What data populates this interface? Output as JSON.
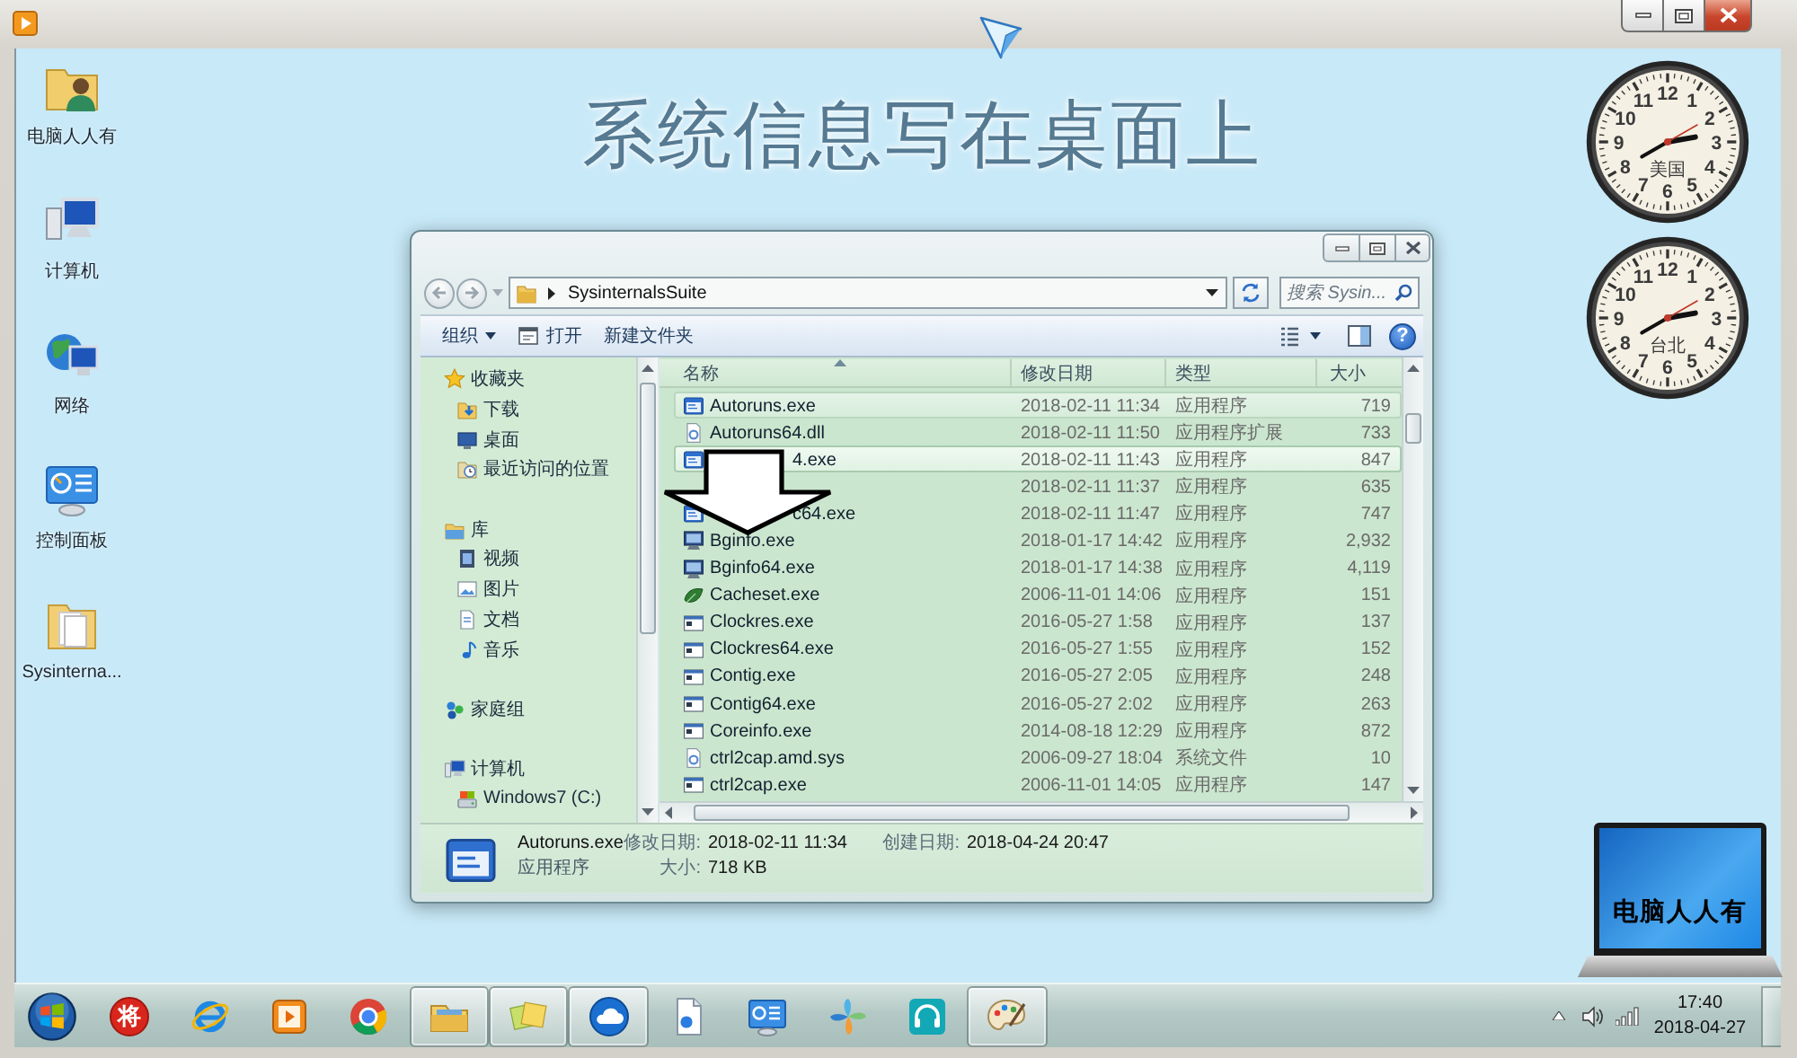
{
  "desktop": {
    "title": "系统信息写在桌面上",
    "icons": [
      {
        "label": "电脑人人有",
        "kind": "user-folder"
      },
      {
        "label": "计算机",
        "kind": "computer"
      },
      {
        "label": "网络",
        "kind": "network"
      },
      {
        "label": "控制面板",
        "kind": "control-panel"
      },
      {
        "label": "Sysinterna...",
        "kind": "folder"
      }
    ]
  },
  "gadgets": {
    "clocks": [
      {
        "city": "美国",
        "numerals": [
          "12",
          "11",
          "1",
          "10",
          "2",
          "9",
          "3",
          "8",
          "4",
          "7",
          "5",
          "6"
        ]
      },
      {
        "city": "台北",
        "numerals": [
          "12",
          "11",
          "1",
          "10",
          "2",
          "9",
          "3",
          "8",
          "4",
          "7",
          "5",
          "6"
        ]
      }
    ],
    "laptop": {
      "screen_text": "电脑人人有"
    }
  },
  "explorer": {
    "address": {
      "path": "SysinternalsSuite"
    },
    "search": {
      "placeholder": "搜索 Sysin..."
    },
    "commands": [
      {
        "label": "组织",
        "kind": "menu"
      },
      {
        "label": "打开",
        "kind": "open"
      },
      {
        "label": "新建文件夹",
        "kind": "plain"
      }
    ],
    "help": "?",
    "nav_pane": [
      {
        "label": "收藏夹",
        "kind": "favorites",
        "children": [
          {
            "label": "下载",
            "kind": "downloads"
          },
          {
            "label": "桌面",
            "kind": "desktop"
          },
          {
            "label": "最近访问的位置",
            "kind": "recent"
          }
        ]
      },
      {
        "label": "库",
        "kind": "libraries",
        "children": [
          {
            "label": "视频",
            "kind": "videos"
          },
          {
            "label": "图片",
            "kind": "pictures"
          },
          {
            "label": "文档",
            "kind": "documents"
          },
          {
            "label": "音乐",
            "kind": "music"
          }
        ]
      },
      {
        "label": "家庭组",
        "kind": "homegroup"
      },
      {
        "label": "计算机",
        "kind": "computer",
        "children": [
          {
            "label": "Windows7 (C:)",
            "kind": "drive"
          }
        ]
      }
    ],
    "files": {
      "columns": [
        "名称",
        "修改日期",
        "类型",
        "大小"
      ],
      "rows": [
        {
          "name": "Autoruns.exe",
          "modified": "2018-02-11 11:34",
          "type": "应用程序",
          "size": "719",
          "kind": "app",
          "selected": true,
          "hovered": false,
          "covered": false
        },
        {
          "name": "Autoruns64.dll",
          "modified": "2018-02-11 11:50",
          "type": "应用程序扩展",
          "size": "733",
          "kind": "library",
          "selected": false,
          "hovered": false,
          "covered": false
        },
        {
          "name": "4.exe",
          "modified": "2018-02-11 11:43",
          "type": "应用程序",
          "size": "847",
          "kind": "app",
          "selected": false,
          "hovered": true,
          "covered": true
        },
        {
          "modified": "2018-02-11 11:37",
          "type": "应用程序",
          "size": "635",
          "selected": false,
          "hovered": false
        },
        {
          "name": "c64.exe",
          "modified": "2018-02-11 11:47",
          "type": "应用程序",
          "size": "747",
          "kind": "app",
          "selected": false,
          "hovered": false,
          "covered": true
        },
        {
          "name": "Bginfo.exe",
          "modified": "2018-01-17 14:42",
          "type": "应用程序",
          "size": "2,932",
          "kind": "monitor",
          "selected": false,
          "hovered": false,
          "covered": false
        },
        {
          "name": "Bginfo64.exe",
          "modified": "2018-01-17 14:38",
          "type": "应用程序",
          "size": "4,119",
          "kind": "monitor",
          "selected": false,
          "hovered": false,
          "covered": false
        },
        {
          "name": "Cacheset.exe",
          "modified": "2006-11-01 14:06",
          "type": "应用程序",
          "size": "151",
          "kind": "leaf",
          "selected": false,
          "hovered": false,
          "covered": false
        },
        {
          "name": "Clockres.exe",
          "modified": "2016-05-27 1:58",
          "type": "应用程序",
          "size": "137",
          "kind": "console",
          "selected": false,
          "hovered": false,
          "covered": false
        },
        {
          "name": "Clockres64.exe",
          "modified": "2016-05-27 1:55",
          "type": "应用程序",
          "size": "152",
          "kind": "console",
          "selected": false,
          "hovered": false,
          "covered": false
        },
        {
          "name": "Contig.exe",
          "modified": "2016-05-27 2:05",
          "type": "应用程序",
          "size": "248",
          "kind": "console",
          "selected": false,
          "hovered": false,
          "covered": false
        },
        {
          "name": "Contig64.exe",
          "modified": "2016-05-27 2:02",
          "type": "应用程序",
          "size": "263",
          "kind": "console",
          "selected": false,
          "hovered": false,
          "covered": false
        },
        {
          "name": "Coreinfo.exe",
          "modified": "2014-08-18 12:29",
          "type": "应用程序",
          "size": "872",
          "kind": "console",
          "selected": false,
          "hovered": false,
          "covered": false
        },
        {
          "name": "ctrl2cap.amd.sys",
          "modified": "2006-09-27 18:04",
          "type": "系统文件",
          "size": "10",
          "kind": "system",
          "selected": false,
          "hovered": false,
          "covered": false
        },
        {
          "name": "ctrl2cap.exe",
          "modified": "2006-11-01 14:05",
          "type": "应用程序",
          "size": "147",
          "kind": "console",
          "selected": false,
          "hovered": false,
          "covered": false
        }
      ]
    },
    "details": {
      "name": "Autoruns.exe",
      "type": "应用程序",
      "modified": {
        "label": "修改日期:",
        "value": "2018-02-11 11:34"
      },
      "created": {
        "label": "创建日期:",
        "value": "2018-04-24 20:47"
      },
      "size": {
        "label": "大小:",
        "value": "718 KB"
      }
    }
  },
  "taskbar": {
    "items": [
      {
        "kind": "start",
        "running": false
      },
      {
        "kind": "seal",
        "label": "将",
        "running": false
      },
      {
        "kind": "browser",
        "running": false
      },
      {
        "kind": "player",
        "running": false
      },
      {
        "kind": "wheel",
        "running": false
      },
      {
        "kind": "folder",
        "running": true
      },
      {
        "kind": "notes",
        "running": true
      },
      {
        "kind": "cloud",
        "running": true
      },
      {
        "kind": "document",
        "running": false
      },
      {
        "kind": "panel",
        "running": false
      },
      {
        "kind": "pinwheel",
        "running": false
      },
      {
        "kind": "headset",
        "running": false
      },
      {
        "kind": "palette",
        "running": true
      }
    ],
    "tray": {
      "time": "17:40",
      "date": "2018-04-27"
    }
  }
}
